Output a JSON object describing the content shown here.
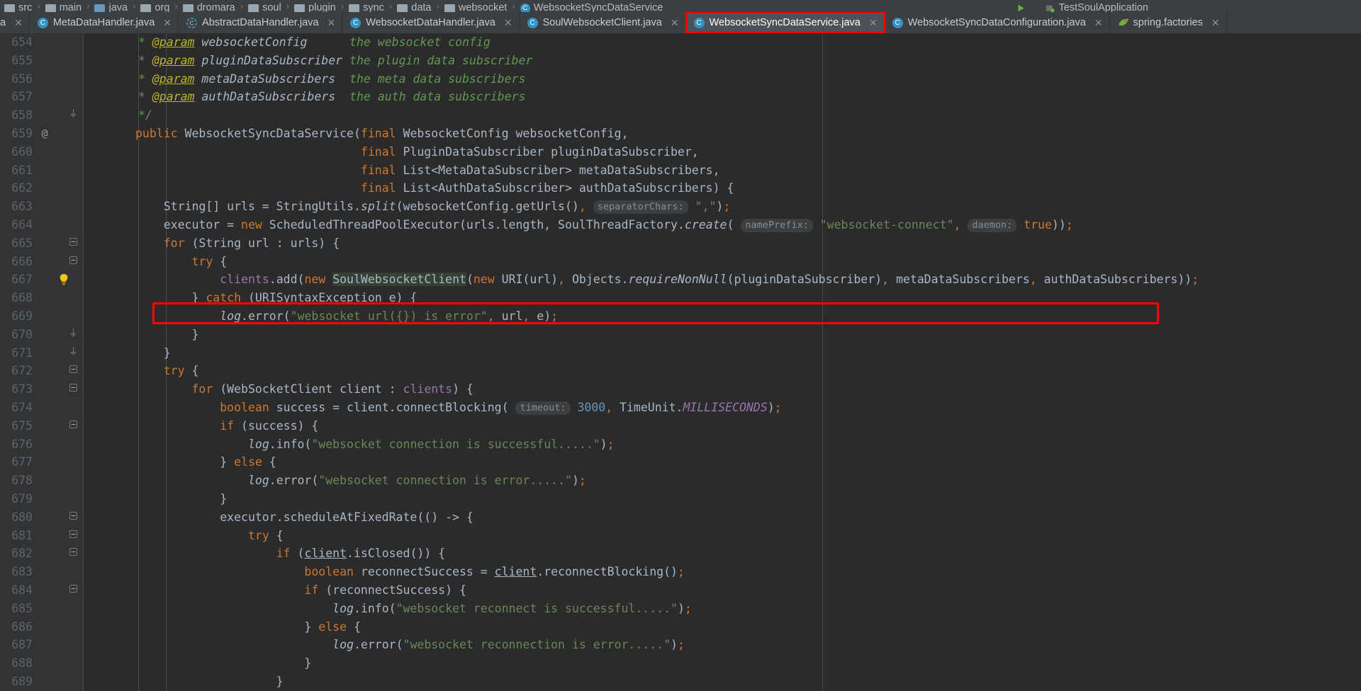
{
  "window": {
    "theme_background": "#2b2b2b",
    "accent": "#3592c4",
    "annotation_color": "#ff0000"
  },
  "breadcrumb": {
    "items": [
      {
        "label": "src",
        "icon": "folder-icon"
      },
      {
        "label": "main",
        "icon": "folder-icon"
      },
      {
        "label": "java",
        "icon": "folder-source-icon"
      },
      {
        "label": "org",
        "icon": "folder-icon"
      },
      {
        "label": "dromara",
        "icon": "folder-icon"
      },
      {
        "label": "soul",
        "icon": "folder-icon"
      },
      {
        "label": "plugin",
        "icon": "folder-icon"
      },
      {
        "label": "sync",
        "icon": "folder-icon"
      },
      {
        "label": "data",
        "icon": "folder-icon"
      },
      {
        "label": "websocket",
        "icon": "folder-icon"
      },
      {
        "label": "WebsocketSyncDataService",
        "icon": "class-icon"
      }
    ],
    "separator": "›",
    "right_items": [
      {
        "label": "",
        "icon": "run-icon"
      },
      {
        "label": "TestSoulApplication",
        "icon": "run-config-icon"
      }
    ]
  },
  "tabs": [
    {
      "label": "a",
      "icon": "class-icon",
      "active": false,
      "close": "✕",
      "truncated": true
    },
    {
      "label": "MetaDataHandler.java",
      "icon": "class-icon",
      "active": false,
      "close": "✕"
    },
    {
      "label": "AbstractDataHandler.java",
      "icon": "abstract-class-icon",
      "active": false,
      "close": "✕"
    },
    {
      "label": "WebsocketDataHandler.java",
      "icon": "class-icon",
      "active": false,
      "close": "✕"
    },
    {
      "label": "SoulWebsocketClient.java",
      "icon": "class-icon",
      "active": false,
      "close": "✕"
    },
    {
      "label": "WebsocketSyncDataService.java",
      "icon": "class-icon",
      "active": true,
      "close": "✕",
      "highlighted": true
    },
    {
      "label": "WebsocketSyncDataConfiguration.java",
      "icon": "class-icon",
      "active": false,
      "close": "✕"
    },
    {
      "label": "spring.factories",
      "icon": "spring-icon",
      "active": false,
      "close": "✕"
    }
  ],
  "editor": {
    "file": "WebsocketSyncDataService.java",
    "first_line_number": 654,
    "lines": [
      {
        "num": 654,
        "annot": "",
        "fold": "",
        "bulb": false
      },
      {
        "num": 655,
        "annot": "",
        "fold": "",
        "bulb": false
      },
      {
        "num": 656,
        "annot": "",
        "fold": "",
        "bulb": false
      },
      {
        "num": 657,
        "annot": "",
        "fold": "",
        "bulb": false
      },
      {
        "num": 658,
        "annot": "",
        "fold": "fold-end",
        "bulb": false
      },
      {
        "num": 659,
        "annot": "@",
        "fold": "",
        "bulb": false
      },
      {
        "num": 660,
        "annot": "",
        "fold": "",
        "bulb": false
      },
      {
        "num": 661,
        "annot": "",
        "fold": "",
        "bulb": false
      },
      {
        "num": 662,
        "annot": "",
        "fold": "",
        "bulb": false
      },
      {
        "num": 663,
        "annot": "",
        "fold": "",
        "bulb": false
      },
      {
        "num": 664,
        "annot": "",
        "fold": "",
        "bulb": false
      },
      {
        "num": 665,
        "annot": "",
        "fold": "fold",
        "bulb": false
      },
      {
        "num": 666,
        "annot": "",
        "fold": "fold",
        "bulb": false
      },
      {
        "num": 667,
        "annot": "",
        "fold": "",
        "bulb": true
      },
      {
        "num": 668,
        "annot": "",
        "fold": "",
        "bulb": false
      },
      {
        "num": 669,
        "annot": "",
        "fold": "",
        "bulb": false
      },
      {
        "num": 670,
        "annot": "",
        "fold": "fold-end",
        "bulb": false
      },
      {
        "num": 671,
        "annot": "",
        "fold": "fold-end",
        "bulb": false
      },
      {
        "num": 672,
        "annot": "",
        "fold": "fold",
        "bulb": false
      },
      {
        "num": 673,
        "annot": "",
        "fold": "fold",
        "bulb": false
      },
      {
        "num": 674,
        "annot": "",
        "fold": "",
        "bulb": false
      },
      {
        "num": 675,
        "annot": "",
        "fold": "fold",
        "bulb": false
      },
      {
        "num": 676,
        "annot": "",
        "fold": "",
        "bulb": false
      },
      {
        "num": 677,
        "annot": "",
        "fold": "",
        "bulb": false
      },
      {
        "num": 678,
        "annot": "",
        "fold": "",
        "bulb": false
      },
      {
        "num": 679,
        "annot": "",
        "fold": "",
        "bulb": false
      },
      {
        "num": 680,
        "annot": "",
        "fold": "fold",
        "bulb": false
      },
      {
        "num": 681,
        "annot": "",
        "fold": "fold",
        "bulb": false
      },
      {
        "num": 682,
        "annot": "",
        "fold": "fold",
        "bulb": false
      },
      {
        "num": 683,
        "annot": "",
        "fold": "",
        "bulb": false
      },
      {
        "num": 684,
        "annot": "",
        "fold": "fold",
        "bulb": false
      },
      {
        "num": 685,
        "annot": "",
        "fold": "",
        "bulb": false
      },
      {
        "num": 686,
        "annot": "",
        "fold": "",
        "bulb": false
      },
      {
        "num": 687,
        "annot": "",
        "fold": "",
        "bulb": false
      },
      {
        "num": 688,
        "annot": "",
        "fold": "",
        "bulb": false
      },
      {
        "num": 689,
        "annot": "",
        "fold": "",
        "bulb": false
      }
    ],
    "source_text": [
      " * @param websocketConfig      the websocket config",
      " * @param pluginDataSubscriber the plugin data subscriber",
      " * @param metaDataSubscribers  the meta data subscribers",
      " * @param authDataSubscribers  the auth data subscribers",
      " */",
      "public WebsocketSyncDataService(final WebsocketConfig websocketConfig,",
      "                                final PluginDataSubscriber pluginDataSubscriber,",
      "                                final List<MetaDataSubscriber> metaDataSubscribers,",
      "                                final List<AuthDataSubscriber> authDataSubscribers) {",
      "    String[] urls = StringUtils.split(websocketConfig.getUrls(), separatorChars: \",\");",
      "    executor = new ScheduledThreadPoolExecutor(urls.length, SoulThreadFactory.create( namePrefix: \"websocket-connect\", daemon: true));",
      "    for (String url : urls) {",
      "        try {",
      "            clients.add(new SoulWebsocketClient(new URI(url), Objects.requireNonNull(pluginDataSubscriber), metaDataSubscribers, authDataSubscribers));",
      "        } catch (URISyntaxException e) {",
      "            log.error(\"websocket url({}) is error\", url, e);",
      "        }",
      "    }",
      "    try {",
      "        for (WebSocketClient client : clients) {",
      "            boolean success = client.connectBlocking( timeout: 3000, TimeUnit.MILLISECONDS);",
      "            if (success) {",
      "                log.info(\"websocket connection is successful.....\");",
      "            } else {",
      "                log.error(\"websocket connection is error.....\");",
      "            }",
      "            executor.scheduleAtFixedRate(() -> {",
      "                try {",
      "                    if (client.isClosed()) {",
      "                        boolean reconnectSuccess = client.reconnectBlocking();",
      "                        if (reconnectSuccess) {",
      "                            log.info(\"websocket reconnect is successful.....\");",
      "                        } else {",
      "                            log.error(\"websocket reconnection is error.....\");",
      "                        }",
      "                    }"
    ],
    "inline_hints": [
      {
        "line": 663,
        "text": "separatorChars:"
      },
      {
        "line": 664,
        "text": "namePrefix:"
      },
      {
        "line": 664,
        "text": "daemon:"
      },
      {
        "line": 674,
        "text": "timeout:"
      }
    ],
    "highlighted_line_number": 667,
    "highlighted_line_text": "clients.add(new SoulWebsocketClient(new URI(url), Objects.requireNonNull(pluginDataSubscriber), metaDataSubscribers, authDataSubscribers));"
  },
  "annotations": [
    {
      "name": "active-tab-box",
      "target": "WebsocketSyncDataService.java tab"
    },
    {
      "name": "code-line-box",
      "target": "line 667 clients.add(...)"
    }
  ]
}
